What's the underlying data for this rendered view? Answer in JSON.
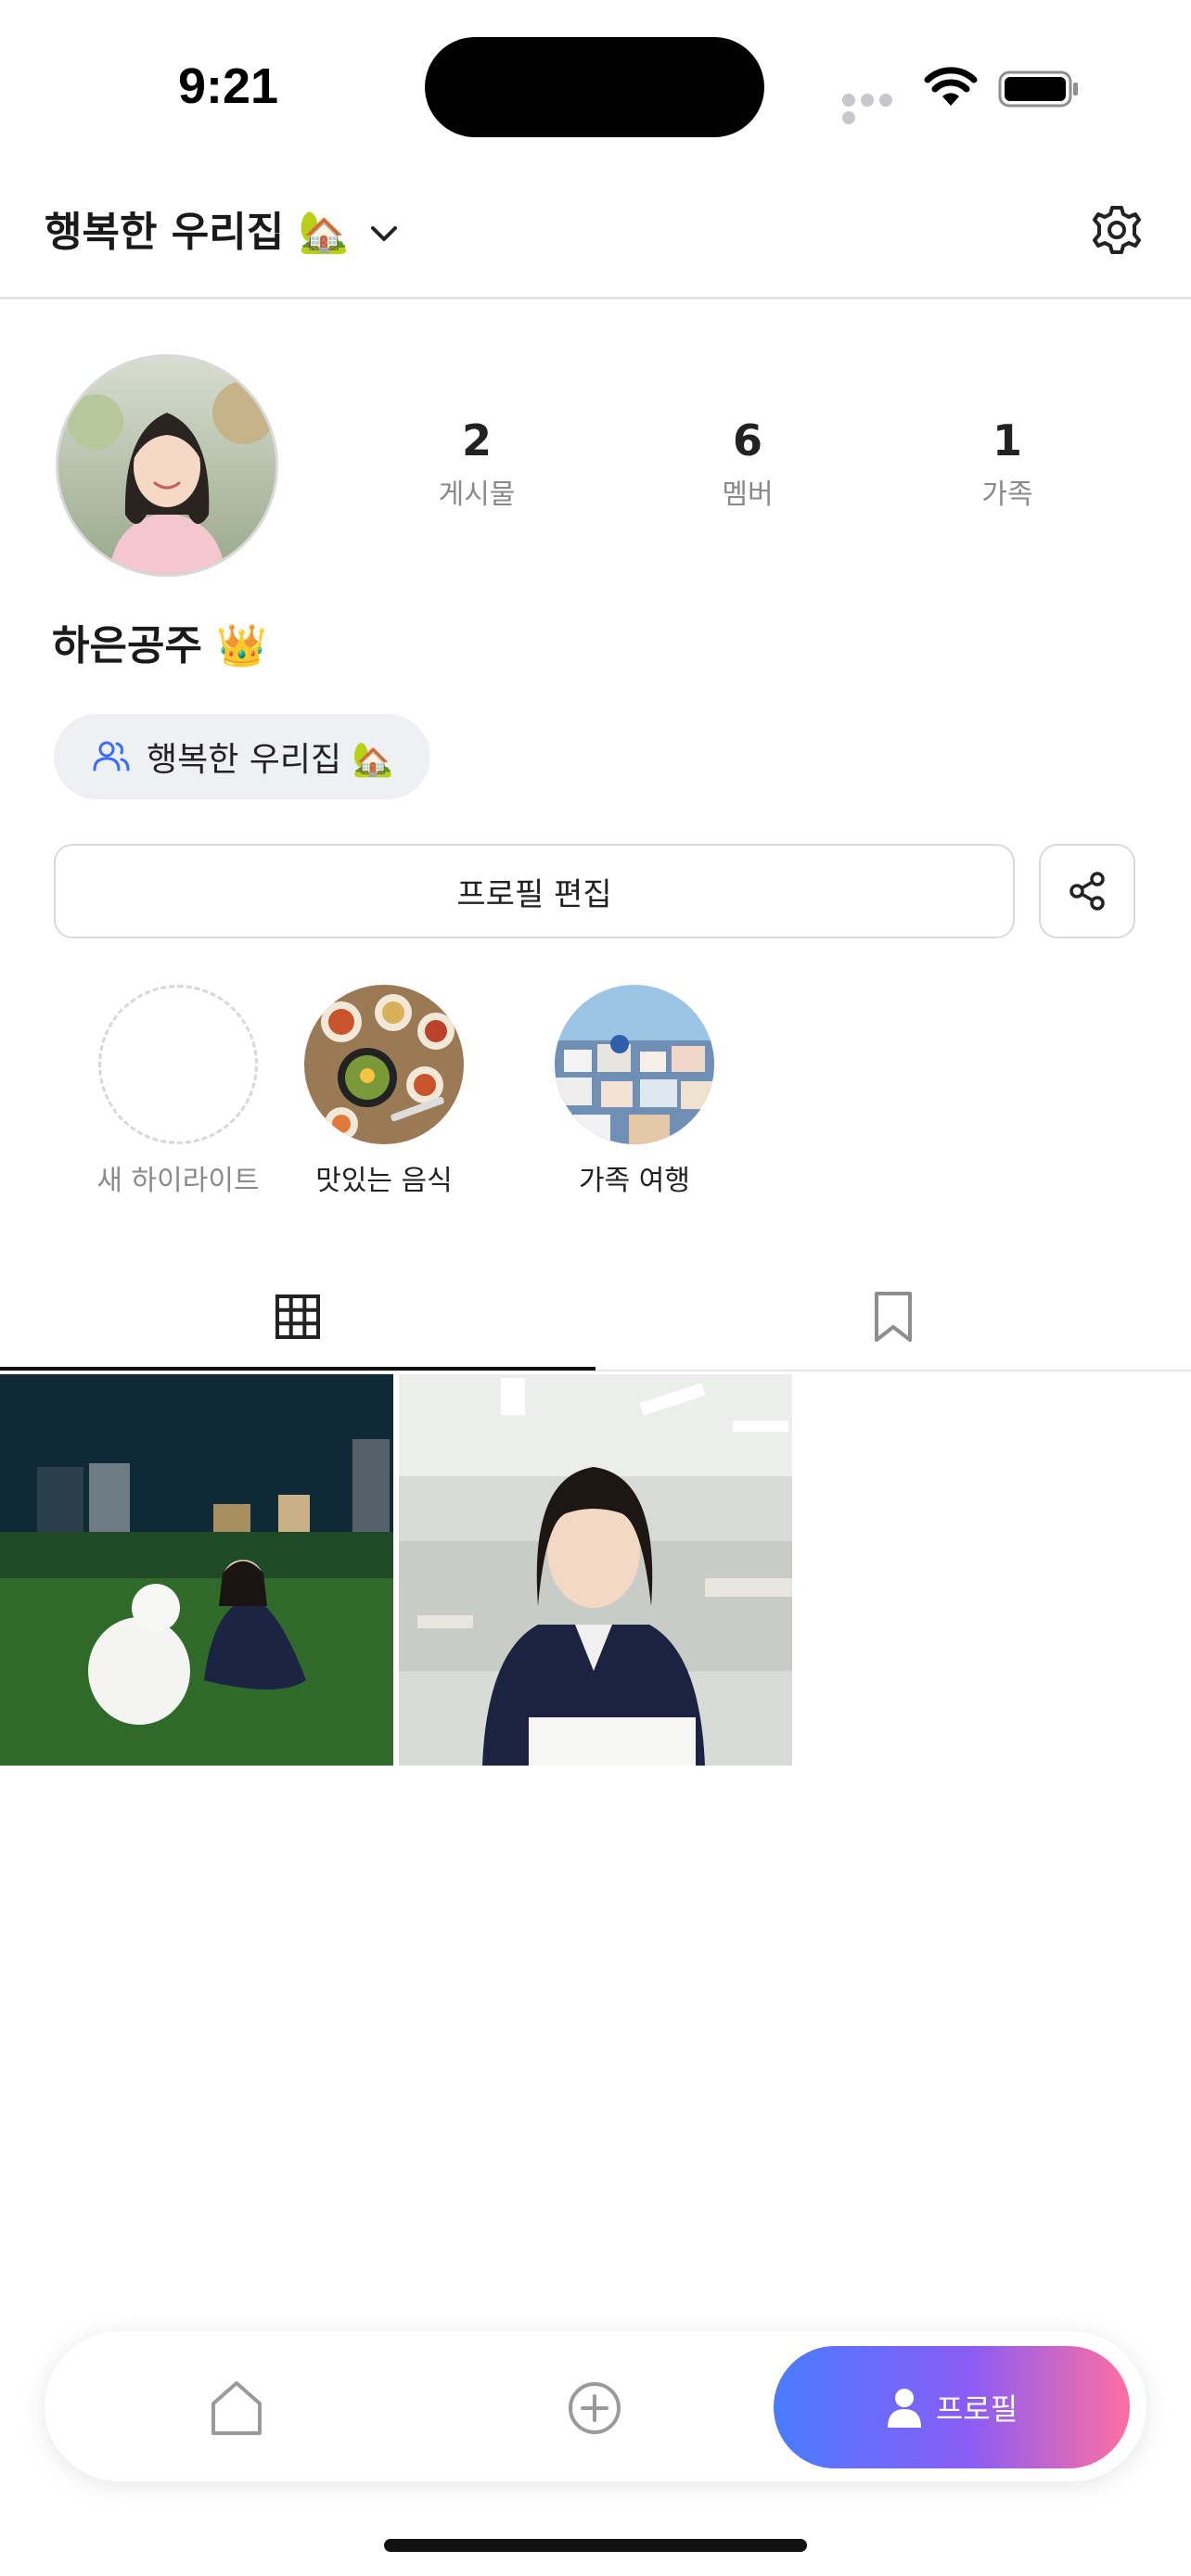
{
  "status_bar": {
    "time": "9:21"
  },
  "header": {
    "title": "행복한 우리집 🏡"
  },
  "profile": {
    "username": "하은공주 👑",
    "stats": [
      {
        "value": "2",
        "label": "게시물"
      },
      {
        "value": "6",
        "label": "멤버"
      },
      {
        "value": "1",
        "label": "가족"
      }
    ],
    "family_chip": "행복한 우리집 🏡",
    "edit_button": "프로필 편집"
  },
  "highlights": [
    {
      "label": "새 하이라이트"
    },
    {
      "label": "맛있는 음식"
    },
    {
      "label": "가족 여행"
    }
  ],
  "tabs": [
    {
      "icon": "grid-icon",
      "selected": true
    },
    {
      "icon": "bookmark-icon",
      "selected": false
    }
  ],
  "posts": [
    {
      "description": "photo-girl-with-dog"
    },
    {
      "description": "photo-girl-in-classroom"
    }
  ],
  "bottom_nav": {
    "items": [
      {
        "icon": "home-icon"
      },
      {
        "icon": "add-circle-icon"
      },
      {
        "icon": "person-icon",
        "label": "프로필",
        "active": true
      }
    ],
    "accent_gradient": [
      "#4a7bff",
      "#8a5cf5",
      "#ff6fa0"
    ]
  }
}
